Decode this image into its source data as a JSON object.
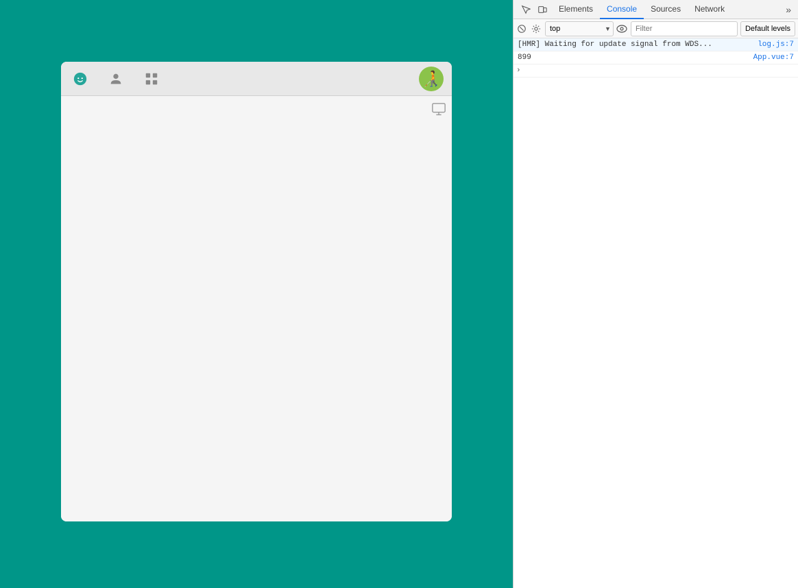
{
  "app": {
    "background_color": "#009688"
  },
  "chat_header": {
    "emoji_icon": "😊",
    "profile_icon": "👤",
    "grid_icon": "⊞",
    "avatar_emoji": "🧑‍🦯"
  },
  "chat_toolbar": {
    "monitor_icon": "🖥"
  },
  "devtools": {
    "tabs": [
      {
        "label": "Elements",
        "active": false
      },
      {
        "label": "Console",
        "active": true
      },
      {
        "label": "Sources",
        "active": false
      },
      {
        "label": "Network",
        "active": false
      }
    ],
    "more_tabs_label": "»",
    "toolbar": {
      "context_value": "top",
      "filter_placeholder": "Filter",
      "levels_label": "Default levels"
    },
    "console_rows": [
      {
        "message": "[HMR] Waiting for update signal from WDS...",
        "source": "log.js:7",
        "count": null,
        "expanded": false
      },
      {
        "message": "899",
        "source": "App.vue:7",
        "count": null,
        "expanded": false
      }
    ],
    "expand_row": {
      "symbol": "›"
    }
  }
}
